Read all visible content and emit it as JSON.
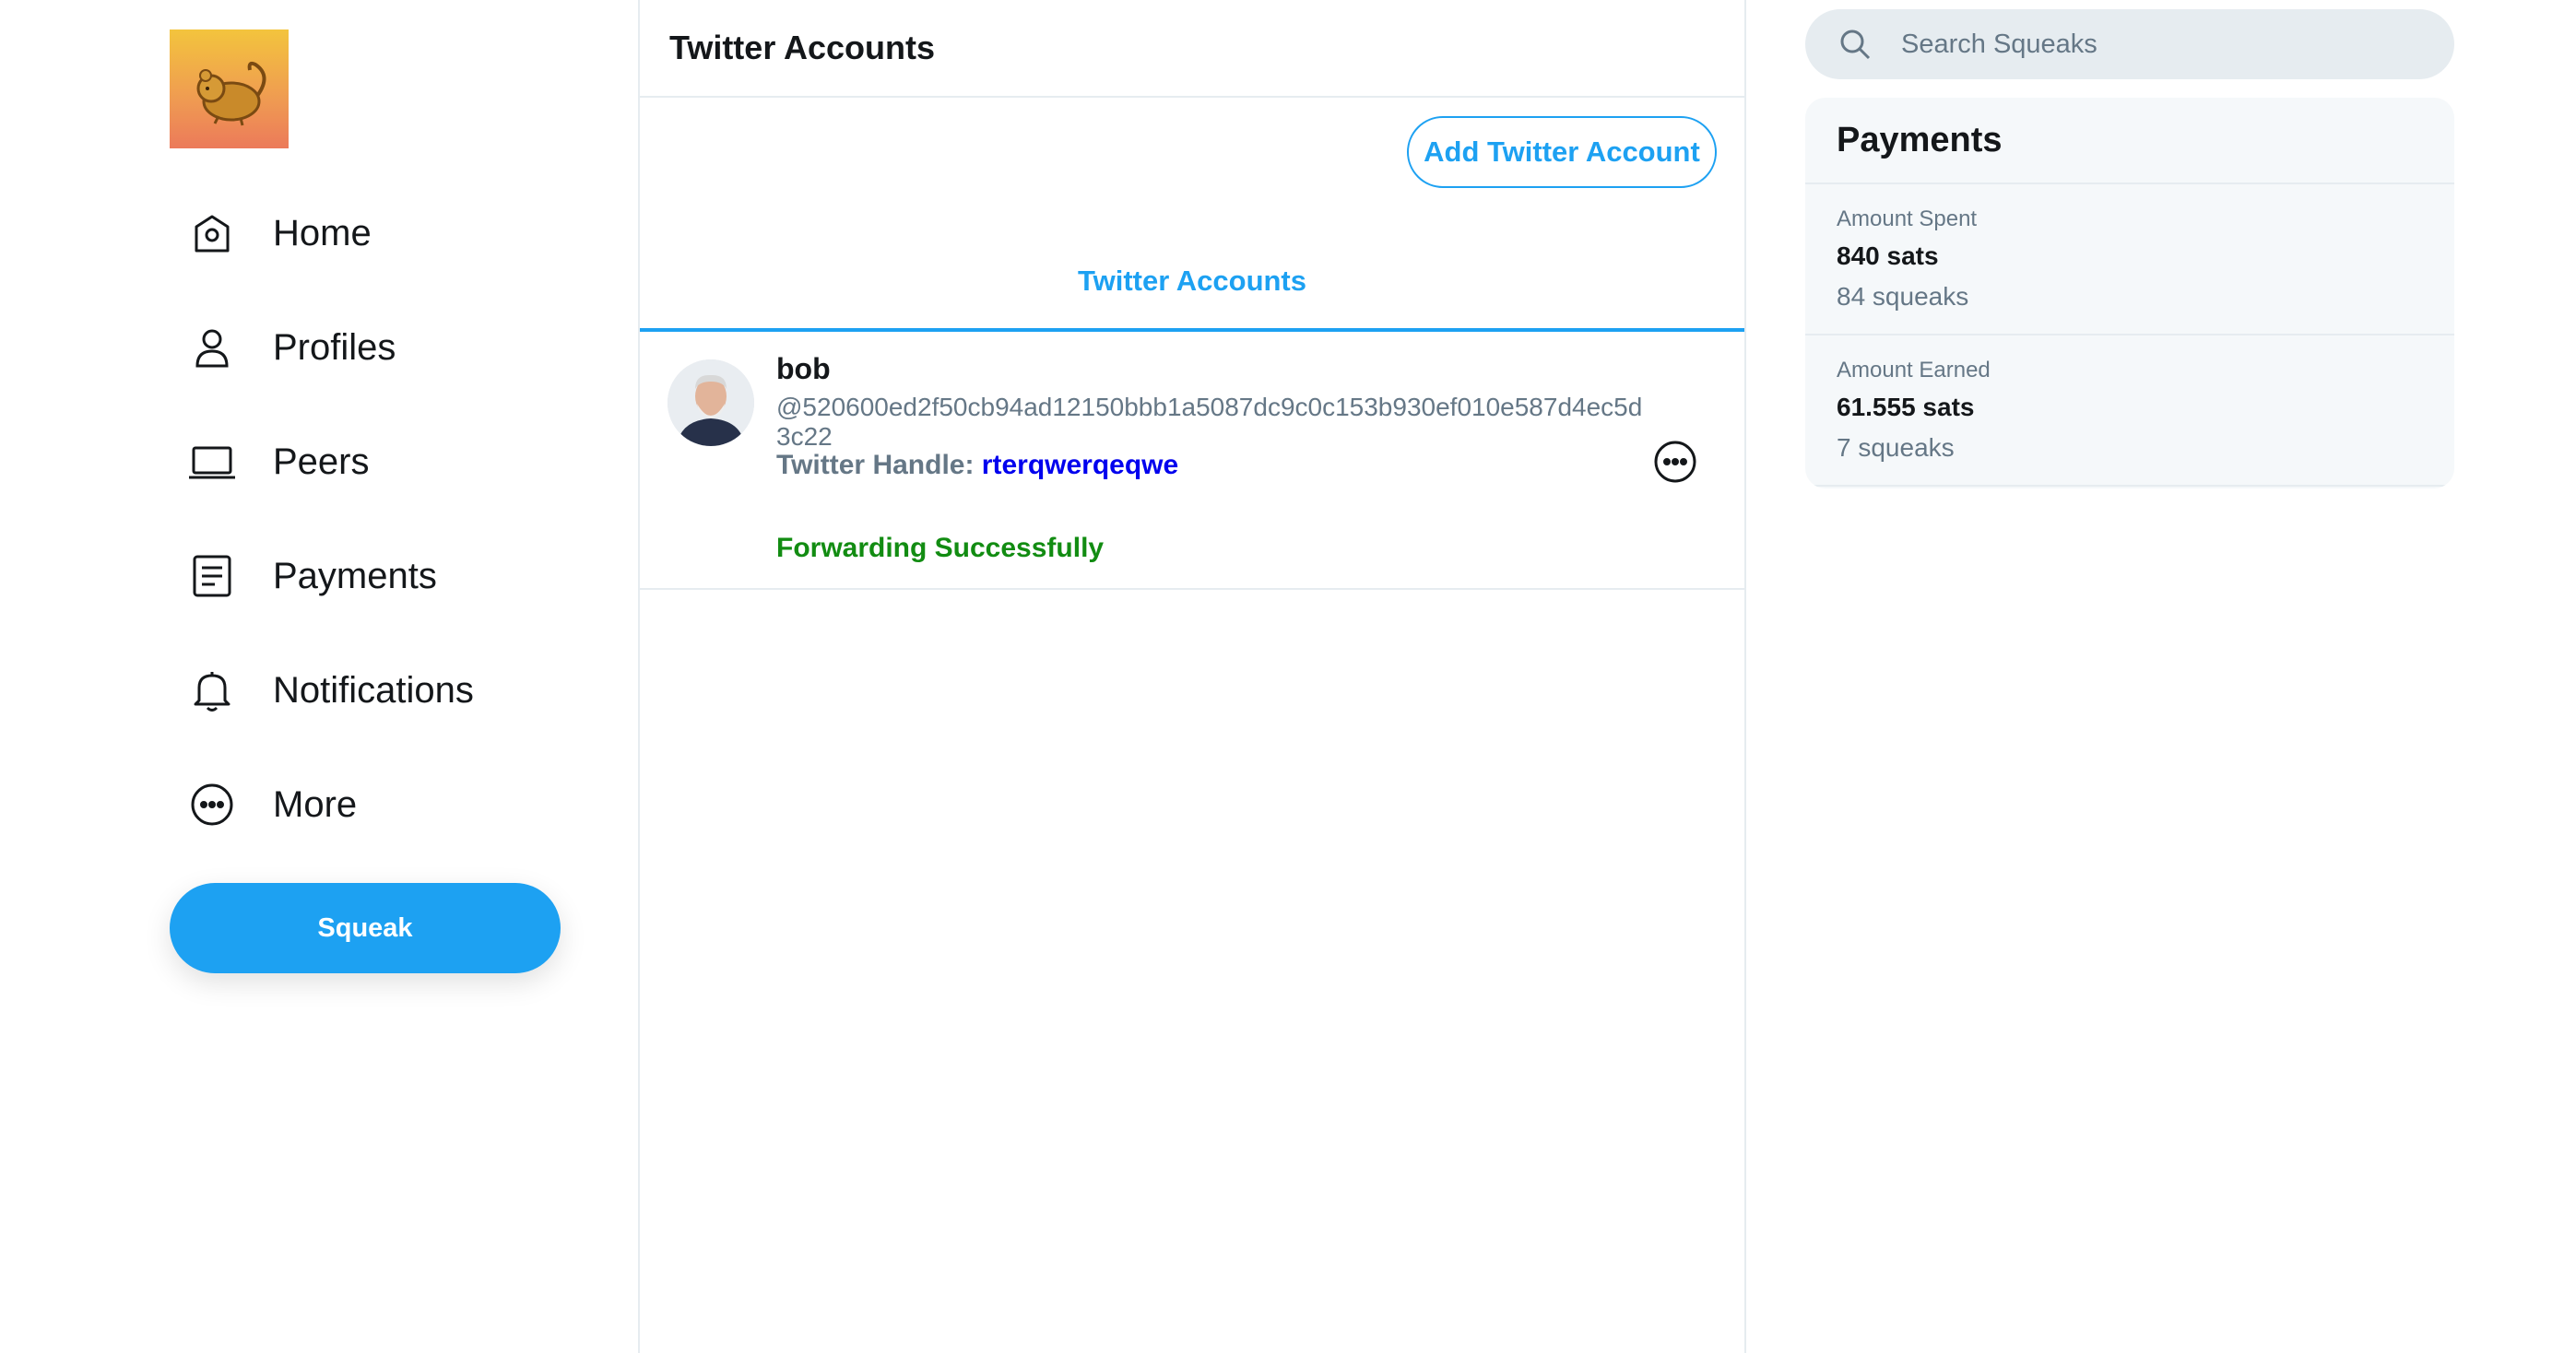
{
  "sidebar": {
    "logo_alt": "Squeaknode logo",
    "items": [
      {
        "label": "Home",
        "icon": "home-icon"
      },
      {
        "label": "Profiles",
        "icon": "user-icon"
      },
      {
        "label": "Peers",
        "icon": "laptop-icon"
      },
      {
        "label": "Payments",
        "icon": "document-icon"
      },
      {
        "label": "Notifications",
        "icon": "bell-icon"
      },
      {
        "label": "More",
        "icon": "more-icon"
      }
    ],
    "squeak_label": "Squeak"
  },
  "main": {
    "title": "Twitter Accounts",
    "add_button_label": "Add Twitter Account",
    "tab_label": "Twitter Accounts",
    "accounts": [
      {
        "name": "bob",
        "pubkey": "@520600ed2f50cb94ad12150bbb1a5087dc9c0c153b930ef010e587d4ec5d3c22",
        "handle_label": "Twitter Handle:",
        "handle": "rterqwerqeqwe",
        "status": "Forwarding Successfully",
        "status_color": "#128c12"
      }
    ]
  },
  "right": {
    "search_placeholder": "Search Squeaks",
    "payments": {
      "title": "Payments",
      "spent_label": "Amount Spent",
      "spent_amount": "840 sats",
      "spent_count": "84 squeaks",
      "earned_label": "Amount Earned",
      "earned_amount": "61.555 sats",
      "earned_count": "7 squeaks"
    }
  },
  "colors": {
    "accent": "#1da1f2",
    "link": "#0000ee",
    "success": "#128c12",
    "muted": "#657786",
    "border": "#e6ecf0"
  }
}
